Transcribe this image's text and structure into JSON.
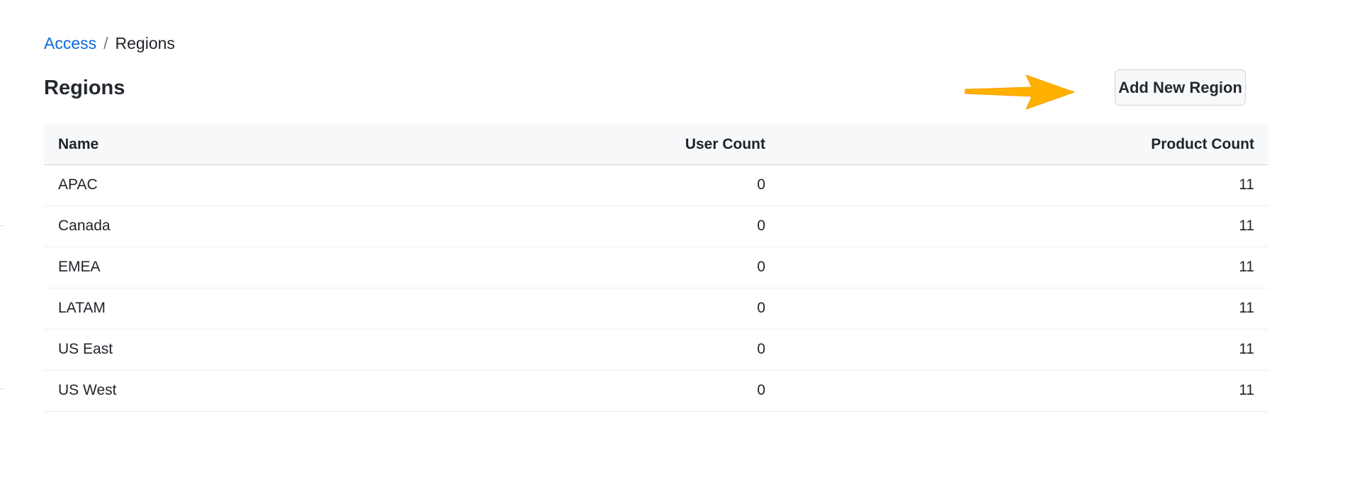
{
  "breadcrumb": {
    "parent": "Access",
    "separator": "/",
    "current": "Regions"
  },
  "page": {
    "title": "Regions"
  },
  "actions": {
    "add_label": "Add New Region"
  },
  "annotation": {
    "arrow_color": "#FFB000"
  },
  "colors": {
    "link": "#0969da",
    "header_bg": "#f6f8fa",
    "border": "#d0d7de"
  },
  "table": {
    "columns": {
      "name": "Name",
      "user_count": "User Count",
      "product_count": "Product Count"
    },
    "rows": [
      {
        "name": "APAC",
        "user_count": "0",
        "product_count": "11"
      },
      {
        "name": "Canada",
        "user_count": "0",
        "product_count": "11"
      },
      {
        "name": "EMEA",
        "user_count": "0",
        "product_count": "11"
      },
      {
        "name": "LATAM",
        "user_count": "0",
        "product_count": "11"
      },
      {
        "name": "US East",
        "user_count": "0",
        "product_count": "11"
      },
      {
        "name": "US West",
        "user_count": "0",
        "product_count": "11"
      }
    ]
  }
}
